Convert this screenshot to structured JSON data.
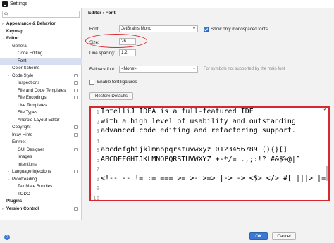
{
  "window": {
    "title": "Settings"
  },
  "search": {
    "placeholder": ""
  },
  "sidebar": {
    "items": [
      {
        "label": "Appearance & Behavior",
        "arrow": "›",
        "bold": true,
        "indent": 0
      },
      {
        "label": "Keymap",
        "arrow": "",
        "bold": true,
        "indent": 0
      },
      {
        "label": "Editor",
        "arrow": "⌄",
        "bold": true,
        "indent": 0
      },
      {
        "label": "General",
        "arrow": "›",
        "bold": false,
        "indent": 1
      },
      {
        "label": "Code Editing",
        "arrow": "",
        "bold": false,
        "indent": 2
      },
      {
        "label": "Font",
        "arrow": "",
        "bold": false,
        "indent": 2,
        "selected": true
      },
      {
        "label": "Color Scheme",
        "arrow": "›",
        "bold": false,
        "indent": 1
      },
      {
        "label": "Code Style",
        "arrow": "›",
        "bold": false,
        "indent": 1,
        "project": true
      },
      {
        "label": "Inspections",
        "arrow": "",
        "bold": false,
        "indent": 2,
        "project": true
      },
      {
        "label": "File and Code Templates",
        "arrow": "",
        "bold": false,
        "indent": 2,
        "project": true
      },
      {
        "label": "File Encodings",
        "arrow": "",
        "bold": false,
        "indent": 2,
        "project": true
      },
      {
        "label": "Live Templates",
        "arrow": "",
        "bold": false,
        "indent": 2
      },
      {
        "label": "File Types",
        "arrow": "",
        "bold": false,
        "indent": 2
      },
      {
        "label": "Android Layout Editor",
        "arrow": "",
        "bold": false,
        "indent": 2
      },
      {
        "label": "Copyright",
        "arrow": "›",
        "bold": false,
        "indent": 1,
        "project": true
      },
      {
        "label": "Inlay Hints",
        "arrow": "›",
        "bold": false,
        "indent": 1,
        "project": true
      },
      {
        "label": "Emmet",
        "arrow": "›",
        "bold": false,
        "indent": 1
      },
      {
        "label": "GUI Designer",
        "arrow": "",
        "bold": false,
        "indent": 2,
        "project": true
      },
      {
        "label": "Images",
        "arrow": "",
        "bold": false,
        "indent": 2
      },
      {
        "label": "Intentions",
        "arrow": "",
        "bold": false,
        "indent": 2
      },
      {
        "label": "Language Injections",
        "arrow": "›",
        "bold": false,
        "indent": 1,
        "project": true
      },
      {
        "label": "Proofreading",
        "arrow": "›",
        "bold": false,
        "indent": 1
      },
      {
        "label": "TextMate Bundles",
        "arrow": "",
        "bold": false,
        "indent": 2
      },
      {
        "label": "TODO",
        "arrow": "",
        "bold": false,
        "indent": 2
      },
      {
        "label": "Plugins",
        "arrow": "",
        "bold": true,
        "indent": 0
      },
      {
        "label": "Version Control",
        "arrow": "›",
        "bold": true,
        "indent": 0,
        "project": true
      }
    ]
  },
  "breadcrumb": {
    "parent": "Editor",
    "separator": " › ",
    "current": "Font"
  },
  "font_settings": {
    "font_label": "Font:",
    "font_value": "JetBrains Mono",
    "monospaced_label": "Show only monospaced fonts",
    "monospaced_checked": true,
    "size_label": "Size:",
    "size_value": "26",
    "line_spacing_label": "Line spacing:",
    "line_spacing_value": "1.2",
    "fallback_label": "Fallback font:",
    "fallback_value": "<None>",
    "fallback_hint": "For symbols not supported by the main font",
    "ligatures_label": "Enable font ligatures",
    "ligatures_checked": false,
    "restore_label": "Restore Defaults"
  },
  "preview": {
    "lines": [
      {
        "num": "1",
        "text": "IntelliJ IDEA is a full-featured IDE"
      },
      {
        "num": "2",
        "text": "with a high level of usability and outstanding"
      },
      {
        "num": "3",
        "text": "advanced code editing and refactoring support."
      },
      {
        "num": "4",
        "text": ""
      },
      {
        "num": "5",
        "text": "abcdefghijklmnopqrstuvwxyz 0123456789 (){}[]"
      },
      {
        "num": "6",
        "text": "ABCDEFGHIJKLMNOPQRSTUVWXYZ +-*/= .,;:!? #&$%@|^"
      },
      {
        "num": "7",
        "text": ""
      },
      {
        "num": "8",
        "text": "<!-- -- != := === >= >- >=> |-> -> <$> </> #[ |||> |= ~@"
      },
      {
        "num": "9",
        "text": ""
      },
      {
        "num": "10",
        "text": ""
      }
    ]
  },
  "footer": {
    "ok_label": "OK",
    "cancel_label": "Cancel",
    "help_label": "?"
  },
  "colors": {
    "accent": "#3b79d4",
    "annotation_red": "#d8282f",
    "selection": "#d5dff0"
  }
}
